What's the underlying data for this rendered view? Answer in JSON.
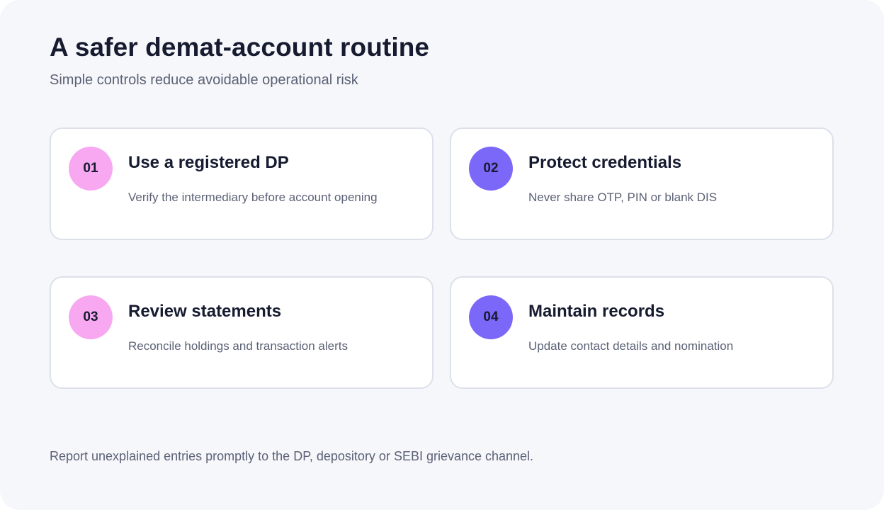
{
  "title": "A safer demat-account routine",
  "subtitle": "Simple controls reduce avoidable operational risk",
  "colors": {
    "background": "#f6f7fb",
    "card_border": "#dde0ea",
    "badge_pink": "#f7a8f0",
    "badge_violet": "#7b68f9",
    "heading": "#161b30",
    "body_text": "#5b6175"
  },
  "cards": [
    {
      "number": "01",
      "title": "Use a registered DP",
      "description": "Verify the intermediary before account opening",
      "badge_color": "#f7a8f0"
    },
    {
      "number": "02",
      "title": "Protect credentials",
      "description": "Never share OTP, PIN or blank DIS",
      "badge_color": "#7b68f9"
    },
    {
      "number": "03",
      "title": "Review statements",
      "description": "Reconcile holdings and transaction alerts",
      "badge_color": "#f7a8f0"
    },
    {
      "number": "04",
      "title": "Maintain records",
      "description": "Update contact details and nomination",
      "badge_color": "#7b68f9"
    }
  ],
  "footer": "Report unexplained entries promptly to the DP, depository or SEBI grievance channel."
}
